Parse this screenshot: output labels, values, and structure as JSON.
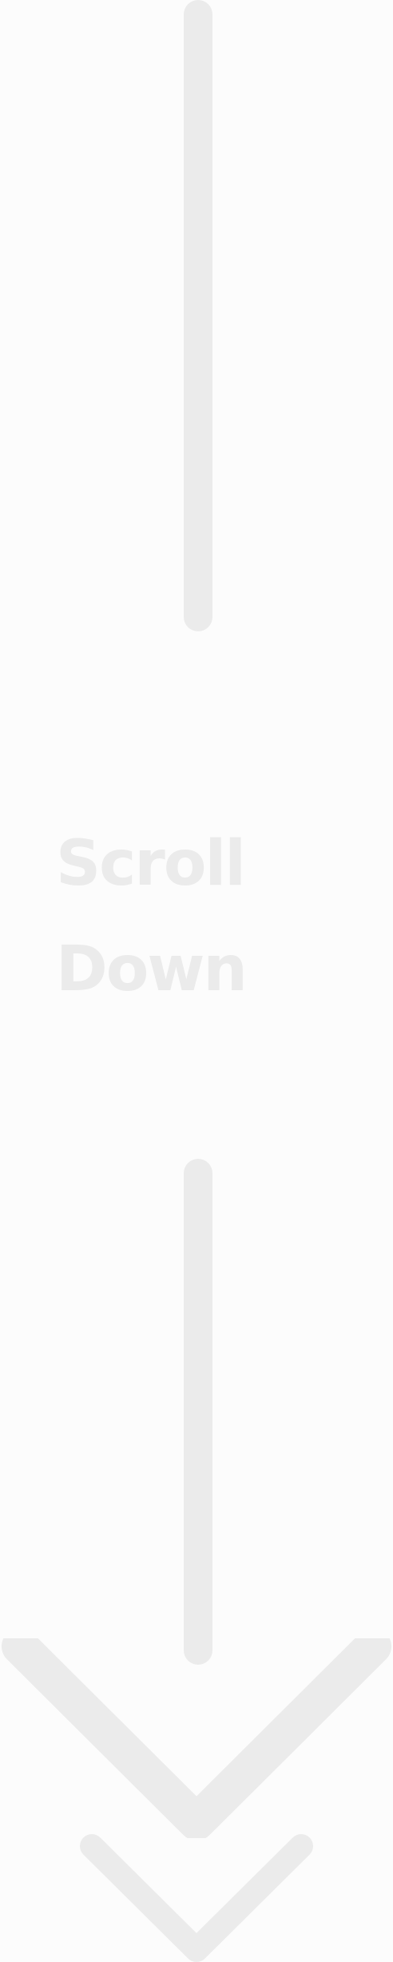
{
  "scroll_hint": {
    "line1": "Scroll",
    "line2": "Down",
    "color": "#ebebeb",
    "background": "#fcfcfc"
  },
  "icons": {
    "top_line": "vertical-line",
    "bottom_line": "vertical-line",
    "big_chevron": "chevron-down-icon",
    "small_chevron": "chevron-down-icon"
  }
}
